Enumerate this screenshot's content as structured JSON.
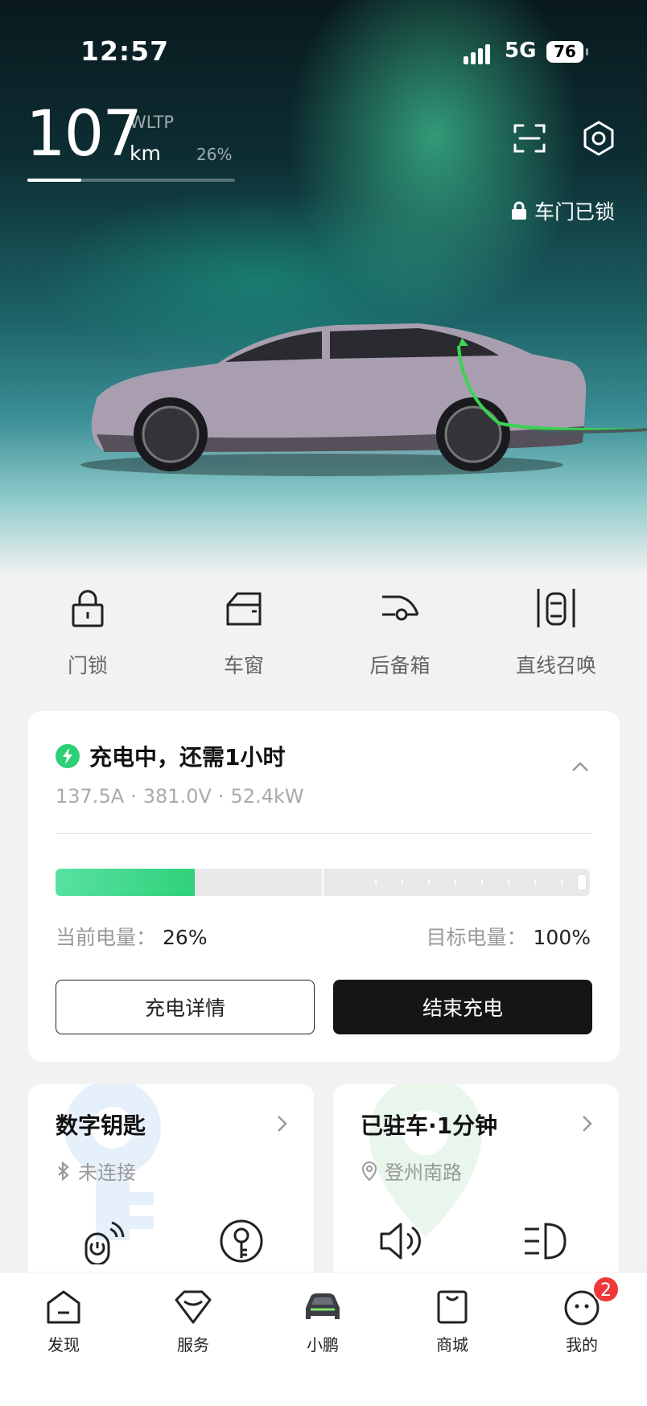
{
  "status_bar": {
    "time": "12:57",
    "network": "5G",
    "battery": "76"
  },
  "range": {
    "value": "107",
    "unit": "km",
    "standard": "WLTP",
    "percent": "26%",
    "fill_fraction": 0.26
  },
  "header_icons": [
    "scan-icon",
    "settings-icon"
  ],
  "door_status": "车门已锁",
  "quick_controls": [
    {
      "icon": "lock-icon",
      "label": "门锁"
    },
    {
      "icon": "window-icon",
      "label": "车窗"
    },
    {
      "icon": "trunk-icon",
      "label": "后备箱"
    },
    {
      "icon": "summon-icon",
      "label": "直线召唤"
    }
  ],
  "charging": {
    "title": "充电中，还需1小时",
    "current": "137.5A",
    "voltage": "381.0V",
    "power": "52.4kW",
    "separator": "·",
    "current_soc_label": "当前电量：",
    "current_soc": "26%",
    "target_soc_label": "目标电量：",
    "target_soc": "100%",
    "soc_fraction": 0.26,
    "details_button": "充电详情",
    "stop_button": "结束充电",
    "accent_color": "#2fd17a"
  },
  "digital_key": {
    "title": "数字钥匙",
    "status": "未连接"
  },
  "parking": {
    "title": "已驻车·1分钟",
    "location": "登州南路"
  },
  "tabs": [
    {
      "icon": "discover-icon",
      "label": "发现"
    },
    {
      "icon": "service-icon",
      "label": "服务"
    },
    {
      "icon": "car-icon",
      "label": "小鹏"
    },
    {
      "icon": "store-icon",
      "label": "商城"
    },
    {
      "icon": "profile-icon",
      "label": "我的",
      "badge": "2"
    }
  ],
  "active_tab": "小鹏"
}
